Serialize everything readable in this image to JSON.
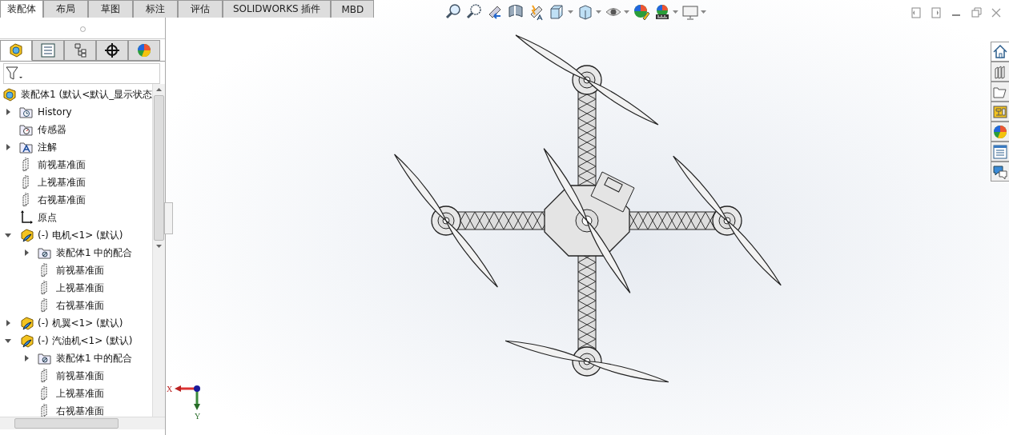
{
  "ribbon_tabs": [
    {
      "label": "装配体",
      "selected": true
    },
    {
      "label": "布局",
      "selected": false
    },
    {
      "label": "草图",
      "selected": false
    },
    {
      "label": "标注",
      "selected": false
    },
    {
      "label": "评估",
      "selected": false
    },
    {
      "label": "SOLIDWORKS 插件",
      "selected": false
    },
    {
      "label": "MBD",
      "selected": false
    }
  ],
  "panel_tabs": [
    {
      "kind": "tree",
      "selected": true
    },
    {
      "kind": "properties",
      "selected": false
    },
    {
      "kind": "config",
      "selected": false
    },
    {
      "kind": "target",
      "selected": false
    },
    {
      "kind": "appearance",
      "selected": false
    }
  ],
  "tree": {
    "root": {
      "label": "装配体1  (默认<默认_显示状态"
    },
    "items": [
      {
        "kind": "history",
        "label": "History",
        "expanded": false
      },
      {
        "kind": "sensor",
        "label": "传感器"
      },
      {
        "kind": "annotation",
        "label": "注解",
        "expanded": false
      },
      {
        "kind": "plane",
        "label": "前视基准面"
      },
      {
        "kind": "plane",
        "label": "上视基准面"
      },
      {
        "kind": "plane",
        "label": "右视基准面"
      },
      {
        "kind": "origin",
        "label": "原点"
      },
      {
        "kind": "part",
        "label": "(-) 电机<1> (默认)",
        "expanded": true,
        "children": [
          {
            "kind": "mates",
            "label": "装配体1 中的配合",
            "expanded": false
          },
          {
            "kind": "plane",
            "label": "前视基准面"
          },
          {
            "kind": "plane",
            "label": "上视基准面"
          },
          {
            "kind": "plane",
            "label": "右视基准面"
          }
        ]
      },
      {
        "kind": "part",
        "label": "(-) 机翼<1> (默认)",
        "expanded": false
      },
      {
        "kind": "part",
        "label": "(-) 汽油机<1> (默认)",
        "expanded": true,
        "children": [
          {
            "kind": "mates",
            "label": "装配体1 中的配合",
            "expanded": false
          },
          {
            "kind": "plane",
            "label": "前视基准面"
          },
          {
            "kind": "plane",
            "label": "上视基准面"
          },
          {
            "kind": "plane",
            "label": "右视基准面"
          }
        ]
      }
    ]
  },
  "task_pane": [
    {
      "kind": "home",
      "selected": true
    },
    {
      "kind": "library",
      "selected": false
    },
    {
      "kind": "explorer",
      "selected": false
    },
    {
      "kind": "palette",
      "selected": false
    },
    {
      "kind": "appearance",
      "selected": false
    },
    {
      "kind": "properties",
      "selected": false
    },
    {
      "kind": "forum",
      "selected": false
    }
  ],
  "triad": {
    "x_label": "X",
    "y_label": "Y"
  }
}
